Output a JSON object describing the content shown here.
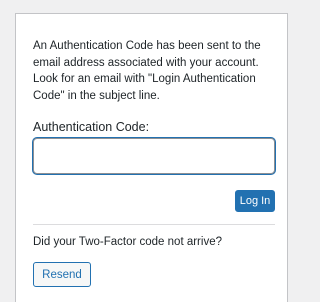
{
  "form": {
    "message": "An Authentication Code has been sent to the email address associated with your account. Look for an email with \"Login Authentication Code\" in the subject line.",
    "code_label": "Authentication Code:",
    "code_value": "",
    "code_placeholder": "",
    "login_label": "Log In",
    "resend_prompt": "Did your Two-Factor code not arrive?",
    "resend_label": "Resend"
  },
  "colors": {
    "page_background": "#f0f0f1",
    "card_background": "#ffffff",
    "primary": "#2271b1",
    "text": "#1d2327",
    "border": "#c3c4c7"
  }
}
